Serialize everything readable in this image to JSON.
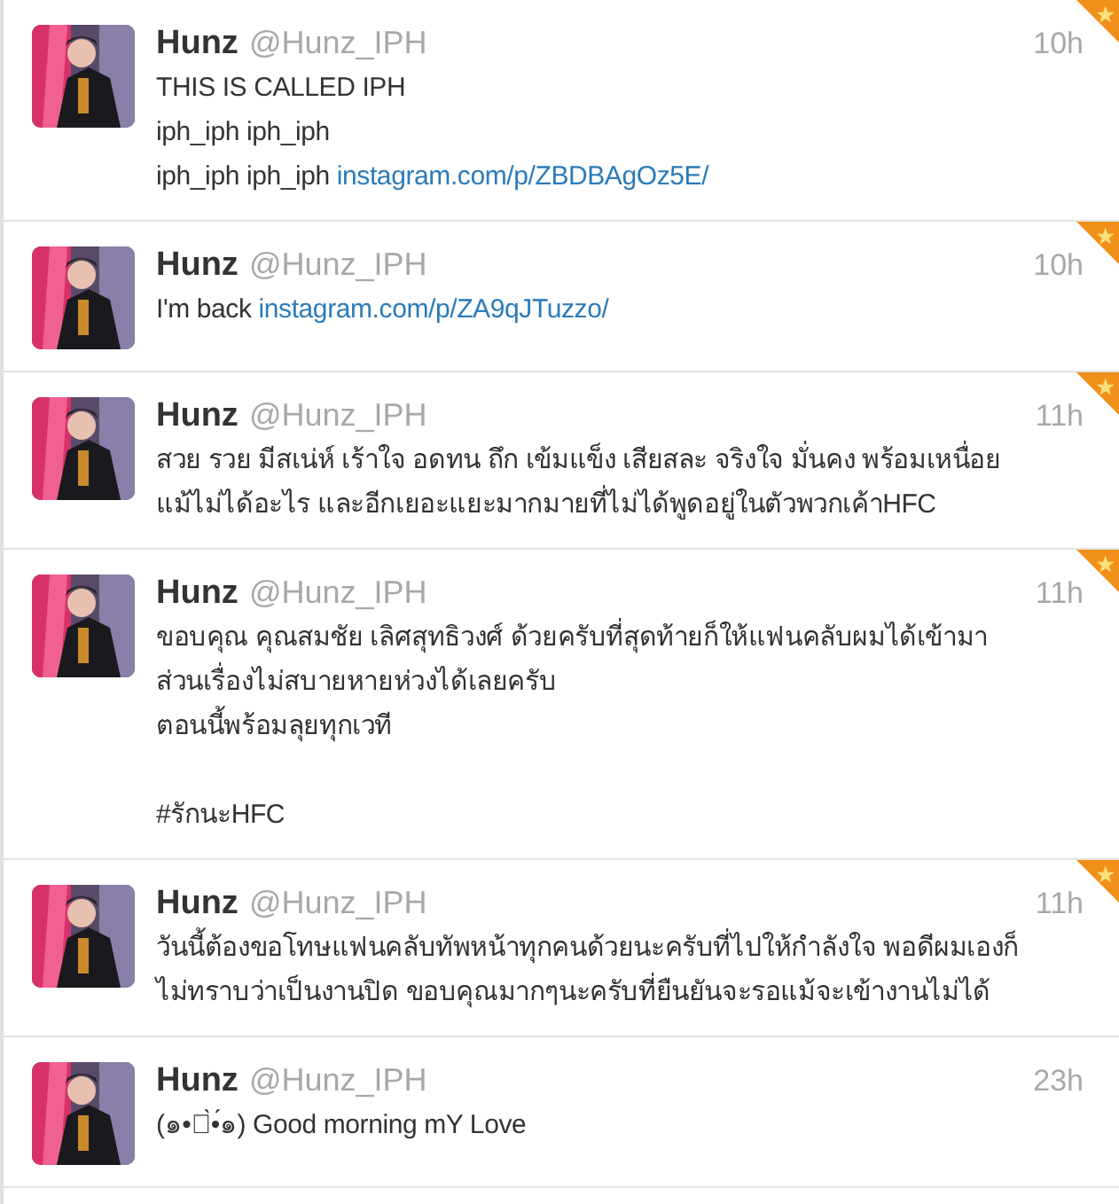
{
  "tweets": [
    {
      "name": "Hunz",
      "handle": "@Hunz_IPH",
      "time": "10h",
      "favorited": true,
      "text": "THIS IS CALLED IPH\niph_iph iph_iph\niph_iph iph_iph ",
      "link": "instagram.com/p/ZBDBAgOz5E/"
    },
    {
      "name": "Hunz",
      "handle": "@Hunz_IPH",
      "time": "10h",
      "favorited": true,
      "text": "I'm back ",
      "link": "instagram.com/p/ZA9qJTuzzo/"
    },
    {
      "name": "Hunz",
      "handle": "@Hunz_IPH",
      "time": "11h",
      "favorited": true,
      "text": "สวย รวย มีสเน่ห์ เร้าใจ อดทน ถึก เข้มแข็ง เสียสละ จริงใจ มั่นคง พร้อมเหนื่อย\nแม้ไม่ได้อะไร และอีกเยอะแยะมากมายที่ไม่ได้พูดอยู่ในตัวพวกเค้าHFC"
    },
    {
      "name": "Hunz",
      "handle": "@Hunz_IPH",
      "time": "11h",
      "favorited": true,
      "text": "ขอบคุณ คุณสมชัย เลิศสุทธิวงศ์ ด้วยครับที่สุดท้ายก็ให้แฟนคลับผมได้เข้ามา\nส่วนเรื่องไม่สบายหายห่วงได้เลยครับ\nตอนนี้พร้อมลุยทุกเวที\n\n#รักนะHFC"
    },
    {
      "name": "Hunz",
      "handle": "@Hunz_IPH",
      "time": "11h",
      "favorited": true,
      "text": "วันนี้ต้องขอโทษแฟนคลับทัพหน้าทุกคนด้วยนะครับที่ไปให้กำลังใจ พอดีผมเองก็\nไม่ทราบว่าเป็นงานปิด ขอบคุณมากๆนะครับที่ยืนยันจะรอแม้จะเข้างานไม่ได้"
    },
    {
      "name": "Hunz",
      "handle": "@Hunz_IPH",
      "time": "23h",
      "favorited": false,
      "text": "(๑•ู̀•́๑) Good morning mY Love"
    }
  ]
}
